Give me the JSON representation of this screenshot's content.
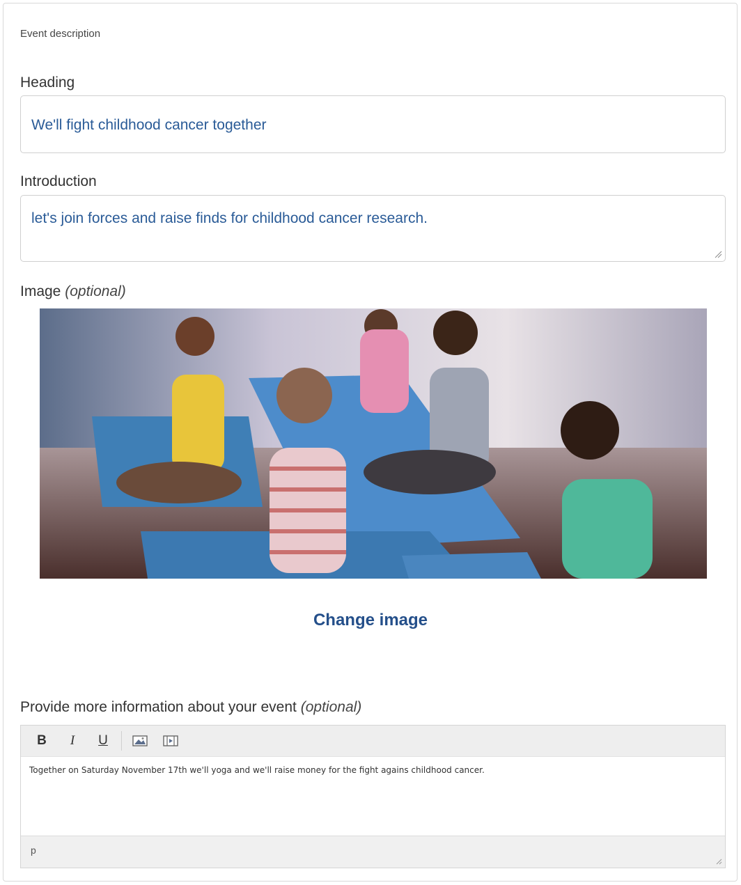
{
  "section": {
    "title": "Event description"
  },
  "heading": {
    "label": "Heading",
    "value": "We'll fight childhood cancer together"
  },
  "introduction": {
    "label": "Introduction",
    "value": "let's join forces and raise finds for childhood cancer research."
  },
  "image": {
    "label": "Image",
    "optional": "(optional)",
    "change_label": "Change image"
  },
  "more_info": {
    "label": "Provide more information about your event",
    "optional": "(optional)",
    "toolbar": {
      "bold": "B",
      "italic": "I",
      "underline": "U"
    },
    "content": "Together on Saturday November 17th we'll yoga and we'll raise money for the fight agains childhood cancer.",
    "status_path": "p"
  },
  "colors": {
    "input_text": "#2a5b97",
    "link": "#244f8a"
  }
}
